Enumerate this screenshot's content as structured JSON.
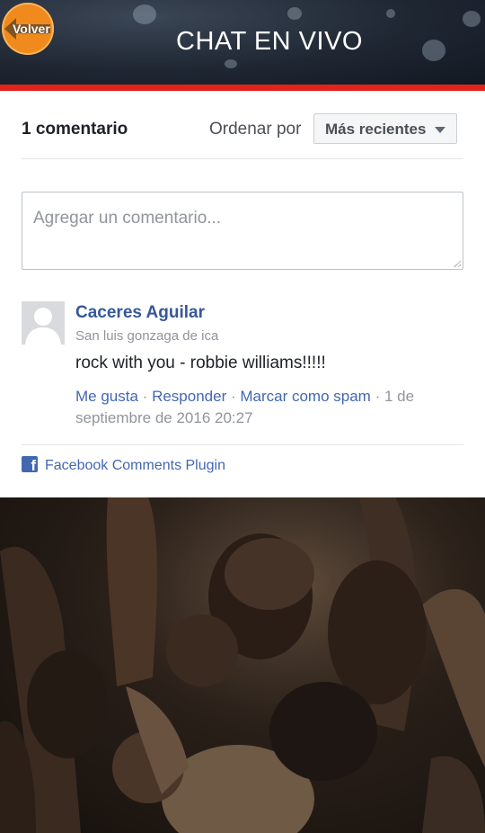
{
  "header": {
    "title": "CHAT EN VIVO",
    "back_label": "Volver",
    "accent": "#e3231b",
    "back_color": "#f08a1d"
  },
  "comments": {
    "count_label": "1 comentario",
    "sort_label": "Ordenar por",
    "sort_selected": "Más recientes",
    "input_placeholder": "Agregar un comentario...",
    "items": [
      {
        "author": "Caceres Aguilar",
        "location": "San luis gonzaga de ica",
        "text": "rock with you - robbie williams!!!!!",
        "like": "Me gusta",
        "reply": "Responder",
        "spam": "Marcar como spam",
        "timestamp": "1 de septiembre de 2016 20:27"
      }
    ],
    "plugin_label": "Facebook Comments Plugin"
  }
}
